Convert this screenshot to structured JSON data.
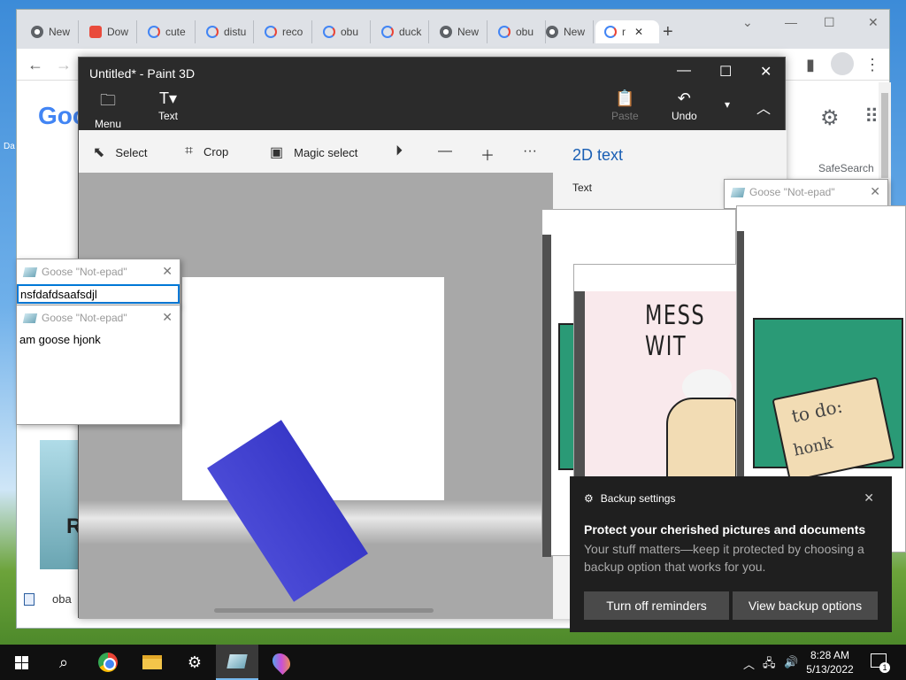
{
  "desktop": {
    "label": "Da"
  },
  "chrome": {
    "tabs": [
      {
        "icon": "chrome-icon",
        "label": "New"
      },
      {
        "icon": "download-app-icon",
        "label": "Dow"
      },
      {
        "icon": "google-icon",
        "label": "cute"
      },
      {
        "icon": "google-icon",
        "label": "distu"
      },
      {
        "icon": "google-icon",
        "label": "reco"
      },
      {
        "icon": "google-icon",
        "label": "obu"
      },
      {
        "icon": "google-icon",
        "label": "duck"
      },
      {
        "icon": "chrome-icon",
        "label": "New"
      },
      {
        "icon": "google-icon",
        "label": "obu"
      },
      {
        "icon": "chrome-icon",
        "label": "New"
      },
      {
        "icon": "google-icon",
        "label": "r"
      }
    ],
    "google_logo": "Goo",
    "safesearch": "SafeSearch",
    "left_letter": "R",
    "bottom_file": "oba"
  },
  "paint": {
    "title": "Untitled* - Paint 3D",
    "menu_label": "Menu",
    "text_label": "Text",
    "paste_label": "Paste",
    "undo_label": "Undo",
    "tools": {
      "select": "Select",
      "crop": "Crop",
      "magic_select": "Magic select"
    },
    "side_title": "2D text",
    "side_label": "Text",
    "shape_color": "#4040d0"
  },
  "goose_windows": [
    {
      "title": "Goose \"Not-epad\"",
      "text": "nsfdafdsaafsdjl"
    },
    {
      "title": "Goose \"Not-epad\"",
      "text": "am goose hjonk"
    },
    {
      "title": "Goose \"Not-epad\"",
      "text": ""
    }
  ],
  "memes": {
    "mess_text": "MESS WIT",
    "todo_text": "to do:",
    "honk_text": "honk"
  },
  "toast": {
    "app": "Backup settings",
    "title": "Protect your cherished pictures and documents",
    "body": "Your stuff matters—keep it protected by choosing a backup option that works for you.",
    "button_off": "Turn off reminders",
    "button_view": "View backup options"
  },
  "taskbar": {
    "time": "8:28 AM",
    "date": "5/13/2022",
    "notifications": "1"
  }
}
